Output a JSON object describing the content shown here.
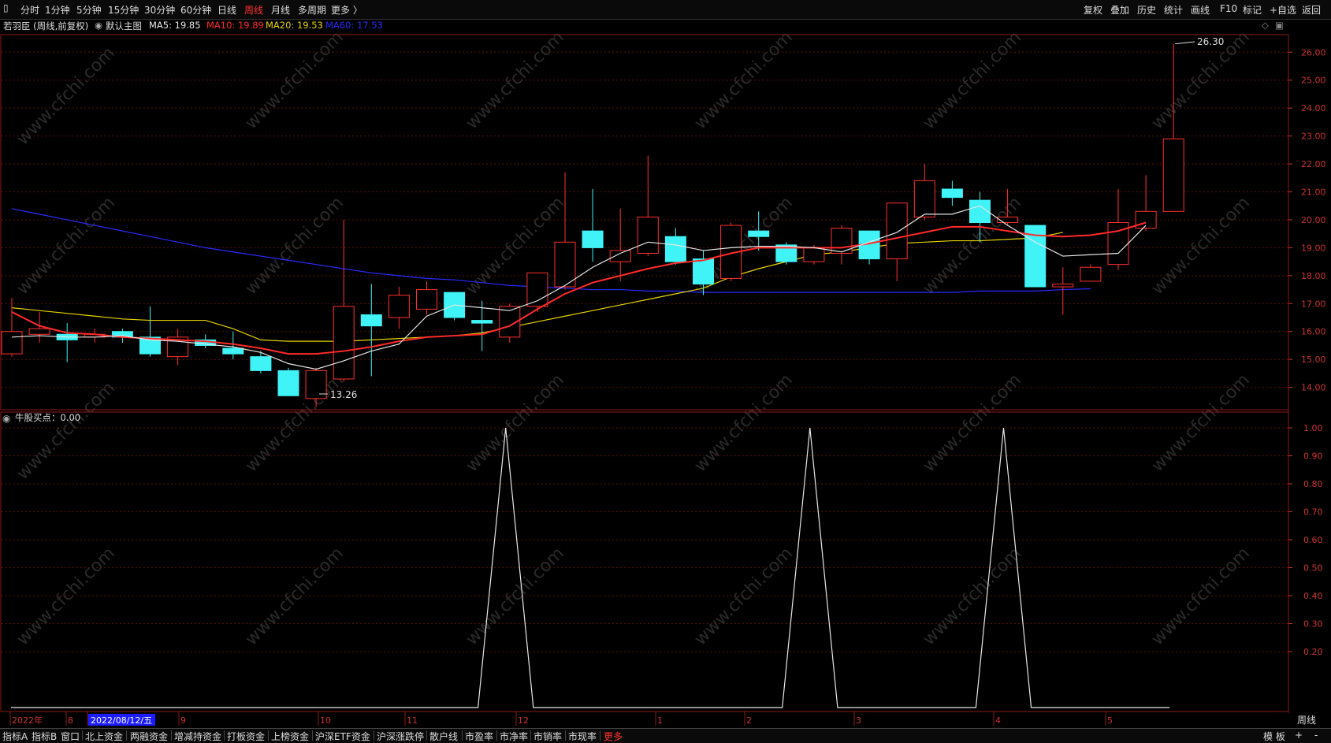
{
  "toolbar": {
    "periods": [
      "分时",
      "1分钟",
      "5分钟",
      "15分钟",
      "30分钟",
      "60分钟",
      "日线",
      "周线",
      "月线",
      "多周期",
      "更多 〉"
    ],
    "active_period": "周线",
    "right_buttons": [
      "复权",
      "叠加",
      "历史",
      "统计",
      "画线",
      "F10",
      "标记",
      "+自选",
      "返回"
    ]
  },
  "info": {
    "stock_title": "若羽臣 (周线,前复权)",
    "main_chart": "默认主图",
    "ma5": "MA5: 19.85",
    "ma10": "MA10: 19.89",
    "ma20": "MA20: 19.53",
    "ma60": "MA60: 17.53",
    "colors": {
      "ma5": "#e6e6e6",
      "ma10": "#ff2a2a",
      "ma20": "#e6d200",
      "ma60": "#2a2aff",
      "up": "#ff3030",
      "down": "#3ff3f7"
    }
  },
  "main_axis": {
    "ticks": [
      "26.00",
      "25.00",
      "24.00",
      "23.00",
      "22.00",
      "21.00",
      "20.00",
      "19.00",
      "18.00",
      "17.00",
      "16.00",
      "15.00",
      "14.00"
    ]
  },
  "annotations": {
    "high": "26.30",
    "low": "13.26"
  },
  "indicator": {
    "title": "牛股买点：0.00",
    "ticks": [
      "1.00",
      "0.90",
      "0.80",
      "0.70",
      "0.60",
      "0.50",
      "0.40",
      "0.30",
      "0.20"
    ]
  },
  "x_axis": {
    "labels": [
      "2022年",
      "8",
      "2022/08/12/五",
      "9",
      "10",
      "11",
      "12",
      "1",
      "2",
      "3",
      "4",
      "5"
    ],
    "right_label": "周线"
  },
  "watermark": "www.cfchi.com",
  "bottom_tabs": [
    "指标A",
    "指标B",
    "窗口",
    "北上资金",
    "两融资金",
    "增减持资金",
    "打板资金",
    "上榜资金",
    "沪深ETF资金",
    "沪深涨跌停",
    "散户线",
    "市盈率",
    "市净率",
    "市销率",
    "市现率",
    "更多"
  ],
  "bottom_right": [
    "模 板",
    "+",
    "-"
  ],
  "chart_data": [
    {
      "type": "candlestick",
      "title": "若羽臣 (周线,前复权)",
      "ylim": [
        13.2,
        26.6
      ],
      "candles": [
        {
          "o": 15.2,
          "c": 16.0,
          "h": 17.2,
          "l": 15.1
        },
        {
          "o": 15.9,
          "c": 16.1,
          "h": 16.7,
          "l": 15.6
        },
        {
          "o": 15.9,
          "c": 15.7,
          "h": 16.3,
          "l": 14.9
        },
        {
          "o": 15.8,
          "c": 15.9,
          "h": 16.1,
          "l": 15.6
        },
        {
          "o": 16.0,
          "c": 15.8,
          "h": 16.1,
          "l": 15.6
        },
        {
          "o": 15.8,
          "c": 15.2,
          "h": 16.9,
          "l": 15.1
        },
        {
          "o": 15.1,
          "c": 15.8,
          "h": 16.1,
          "l": 14.8
        },
        {
          "o": 15.7,
          "c": 15.5,
          "h": 15.9,
          "l": 15.4
        },
        {
          "o": 15.4,
          "c": 15.2,
          "h": 16.0,
          "l": 15.0
        },
        {
          "o": 15.1,
          "c": 14.6,
          "h": 15.3,
          "l": 14.5
        },
        {
          "o": 14.6,
          "c": 13.7,
          "h": 14.7,
          "l": 13.7
        },
        {
          "o": 13.6,
          "c": 14.6,
          "h": 14.7,
          "l": 13.3
        },
        {
          "o": 14.3,
          "c": 16.9,
          "h": 20.0,
          "l": 14.2
        },
        {
          "o": 16.6,
          "c": 16.2,
          "h": 17.7,
          "l": 14.4
        },
        {
          "o": 16.5,
          "c": 17.3,
          "h": 17.6,
          "l": 16.1
        },
        {
          "o": 16.8,
          "c": 17.5,
          "h": 17.8,
          "l": 16.6
        },
        {
          "o": 17.4,
          "c": 16.5,
          "h": 17.4,
          "l": 16.4
        },
        {
          "o": 16.4,
          "c": 16.3,
          "h": 17.1,
          "l": 15.3
        },
        {
          "o": 15.8,
          "c": 16.9,
          "h": 17.0,
          "l": 15.6
        },
        {
          "o": 16.9,
          "c": 18.1,
          "h": 18.1,
          "l": 16.7
        },
        {
          "o": 17.6,
          "c": 19.2,
          "h": 21.7,
          "l": 17.5
        },
        {
          "o": 19.6,
          "c": 19.0,
          "h": 21.1,
          "l": 18.5
        },
        {
          "o": 18.5,
          "c": 18.9,
          "h": 20.4,
          "l": 17.8
        },
        {
          "o": 18.8,
          "c": 20.1,
          "h": 22.3,
          "l": 18.7
        },
        {
          "o": 19.4,
          "c": 18.5,
          "h": 19.7,
          "l": 18.4
        },
        {
          "o": 18.6,
          "c": 17.7,
          "h": 18.9,
          "l": 17.3
        },
        {
          "o": 17.9,
          "c": 19.8,
          "h": 19.9,
          "l": 17.8
        },
        {
          "o": 19.6,
          "c": 19.4,
          "h": 20.3,
          "l": 18.9
        },
        {
          "o": 19.1,
          "c": 18.5,
          "h": 19.2,
          "l": 18.4
        },
        {
          "o": 18.5,
          "c": 19.0,
          "h": 19.1,
          "l": 18.4
        },
        {
          "o": 18.8,
          "c": 19.7,
          "h": 19.8,
          "l": 18.4
        },
        {
          "o": 19.6,
          "c": 18.6,
          "h": 19.6,
          "l": 18.4
        },
        {
          "o": 18.6,
          "c": 20.6,
          "h": 20.6,
          "l": 17.8
        },
        {
          "o": 20.1,
          "c": 21.4,
          "h": 22.0,
          "l": 20.0
        },
        {
          "o": 21.1,
          "c": 20.8,
          "h": 21.4,
          "l": 20.5
        },
        {
          "o": 20.7,
          "c": 19.9,
          "h": 21.0,
          "l": 19.2
        },
        {
          "o": 19.9,
          "c": 20.1,
          "h": 21.1,
          "l": 19.8
        },
        {
          "o": 19.8,
          "c": 17.6,
          "h": 19.8,
          "l": 17.6
        },
        {
          "o": 17.6,
          "c": 17.7,
          "h": 18.3,
          "l": 16.6
        },
        {
          "o": 17.8,
          "c": 18.3,
          "h": 18.4,
          "l": 17.8
        },
        {
          "o": 18.4,
          "c": 19.9,
          "h": 21.1,
          "l": 18.2
        },
        {
          "o": 19.7,
          "c": 20.3,
          "h": 21.6,
          "l": 19.6
        },
        {
          "o": 20.3,
          "c": 22.9,
          "h": 26.3,
          "l": 20.3
        }
      ],
      "ma5": [
        15.8,
        15.85,
        15.8,
        15.8,
        15.85,
        15.7,
        15.65,
        15.55,
        15.45,
        15.25,
        14.85,
        14.65,
        14.95,
        15.3,
        15.55,
        16.55,
        16.95,
        16.85,
        16.75,
        17.1,
        17.65,
        18.3,
        18.8,
        19.2,
        19.1,
        18.9,
        19.0,
        19.05,
        19.05,
        19.0,
        18.85,
        19.2,
        19.55,
        20.2,
        20.2,
        20.5,
        19.8,
        19.2,
        18.7,
        18.75,
        18.8,
        19.8
      ],
      "ma10": [
        16.7,
        16.2,
        15.95,
        15.9,
        15.8,
        15.75,
        15.7,
        15.65,
        15.55,
        15.4,
        15.2,
        15.2,
        15.3,
        15.45,
        15.65,
        15.8,
        15.85,
        15.9,
        16.2,
        16.8,
        17.35,
        17.75,
        18.0,
        18.25,
        18.45,
        18.55,
        18.8,
        19.0,
        19.0,
        19.0,
        19.0,
        19.15,
        19.35,
        19.55,
        19.75,
        19.75,
        19.6,
        19.45,
        19.4,
        19.45,
        19.6,
        19.9
      ],
      "ma20": [
        16.85,
        16.75,
        16.65,
        16.55,
        16.45,
        16.4,
        16.4,
        16.4,
        16.1,
        15.7,
        15.65,
        15.65,
        15.65,
        15.7,
        15.75,
        15.8,
        15.85,
        15.95,
        16.15,
        16.35,
        16.55,
        16.75,
        16.95,
        17.15,
        17.35,
        17.55,
        17.95,
        18.25,
        18.5,
        18.75,
        18.85,
        19.0,
        19.15,
        19.2,
        19.25,
        19.25,
        19.3,
        19.35,
        19.55
      ],
      "ma60": [
        20.4,
        20.2,
        20.0,
        19.8,
        19.6,
        19.4,
        19.2,
        19.0,
        18.85,
        18.7,
        18.55,
        18.4,
        18.25,
        18.1,
        18.0,
        17.9,
        17.85,
        17.75,
        17.65,
        17.6,
        17.55,
        17.5,
        17.5,
        17.45,
        17.45,
        17.4,
        17.4,
        17.4,
        17.4,
        17.4,
        17.4,
        17.4,
        17.4,
        17.4,
        17.4,
        17.45,
        17.45,
        17.45,
        17.5,
        17.53
      ]
    },
    {
      "type": "line",
      "title": "牛股买点",
      "ylim": [
        0,
        1.05
      ],
      "values": [
        0,
        0,
        0,
        0,
        0,
        0,
        0,
        0,
        0,
        0,
        0,
        0,
        0,
        0,
        0,
        0,
        0,
        1,
        0,
        0,
        0,
        0,
        0,
        0,
        0,
        0,
        0,
        0,
        1,
        0,
        0,
        0,
        0,
        0,
        0,
        1,
        0,
        0,
        0,
        0,
        0,
        0
      ]
    }
  ]
}
